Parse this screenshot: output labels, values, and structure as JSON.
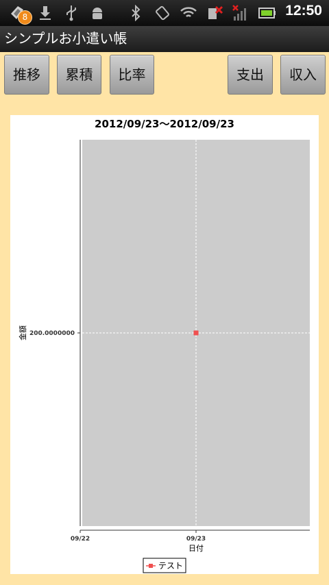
{
  "status_bar": {
    "notification_count": "8",
    "clock": "12:50",
    "icons": [
      "app-notification-icon",
      "download-icon",
      "usb-icon",
      "android-debug-icon",
      "bluetooth-icon",
      "rotation-icon",
      "wifi-icon",
      "no-sim-icon",
      "no-signal-icon",
      "battery-icon"
    ]
  },
  "app": {
    "title": "シンプルお小遣い帳"
  },
  "toolbar": {
    "trend_label": "推移",
    "cumulative_label": "累積",
    "ratio_label": "比率",
    "expense_label": "支出",
    "income_label": "収入"
  },
  "colors": {
    "background": "#ffe4a6",
    "plot_area": "#cccccc",
    "series": "#f05050"
  },
  "chart_data": {
    "type": "line",
    "title": "2012/09/23～2012/09/23",
    "xlabel": "日付",
    "ylabel": "金額",
    "x_ticks": [
      "09/22",
      "09/23"
    ],
    "y_ticks": [
      200.0
    ],
    "y_tick_labels": [
      "200.0000000"
    ],
    "ylim": [
      100.0,
      300.0
    ],
    "grid": true,
    "legend": "bottom-center",
    "series": [
      {
        "name": "テスト",
        "points": [
          {
            "x": "09/23",
            "y": 200.0
          }
        ]
      }
    ]
  }
}
